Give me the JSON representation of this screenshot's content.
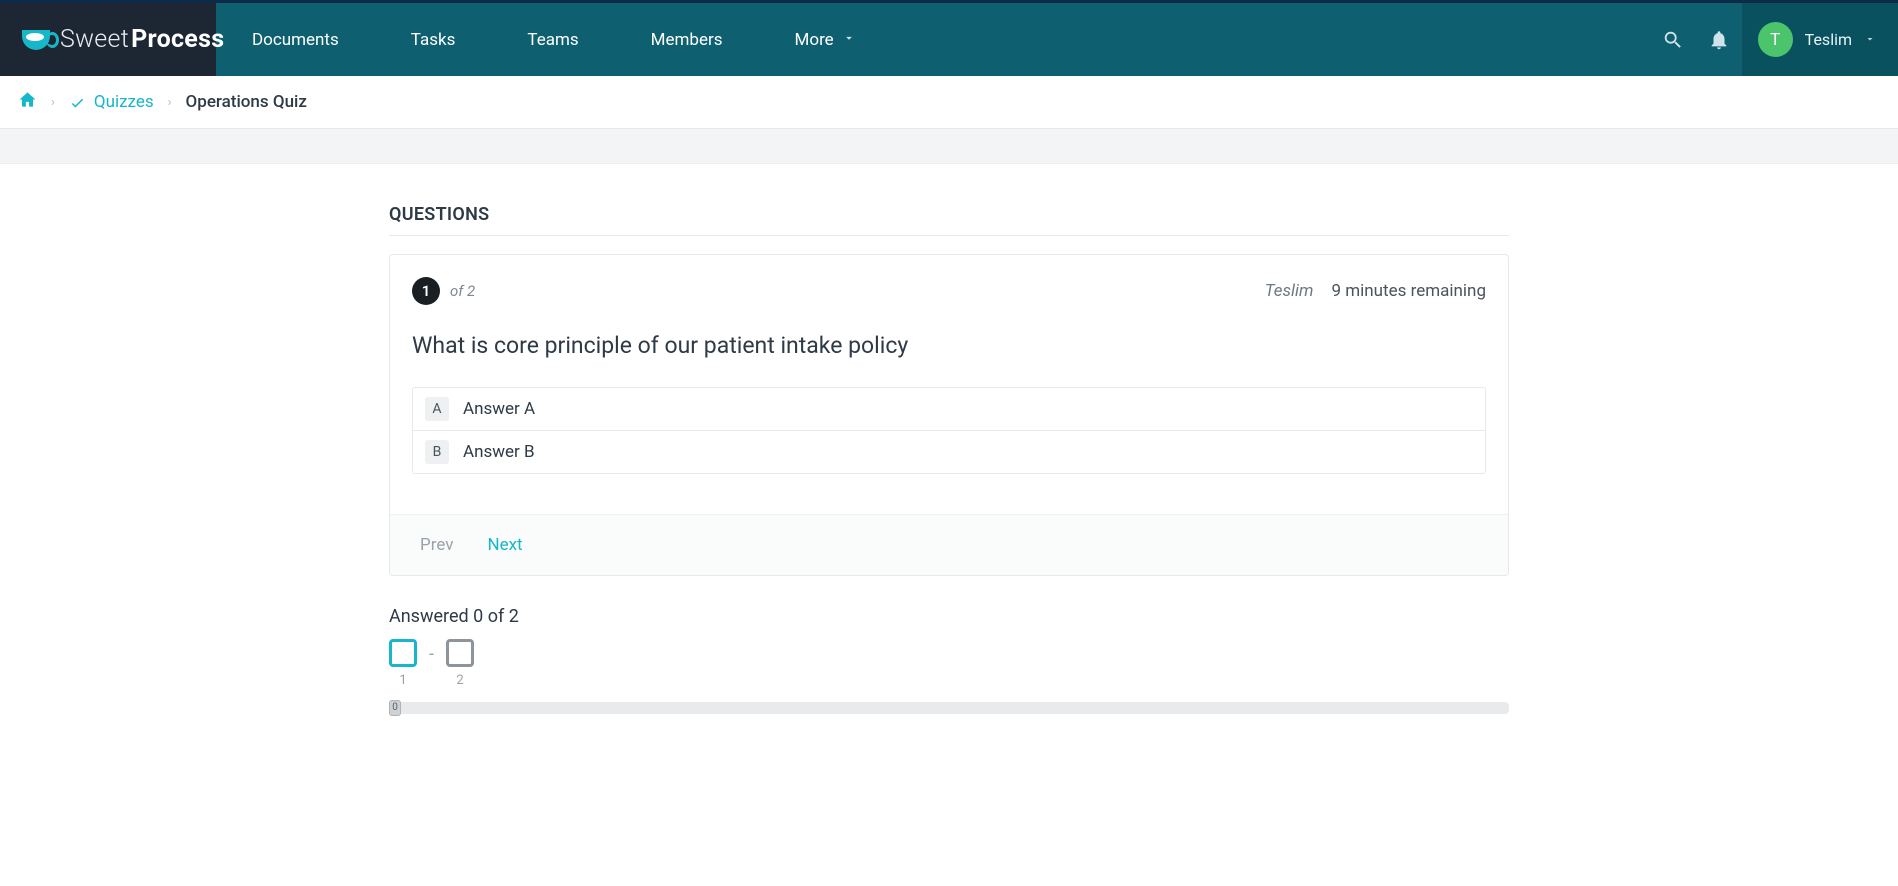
{
  "brand": {
    "sweet": "Sweet",
    "process": "Process"
  },
  "nav": {
    "items": [
      {
        "label": "Documents"
      },
      {
        "label": "Tasks"
      },
      {
        "label": "Teams"
      },
      {
        "label": "Members"
      },
      {
        "label": "More"
      }
    ]
  },
  "user": {
    "name": "Teslim",
    "initial": "T"
  },
  "breadcrumb": {
    "quizzes": "Quizzes",
    "current": "Operations Quiz"
  },
  "section_title": "QUESTIONS",
  "question": {
    "number": "1",
    "of_text": "of 2",
    "user": "Teslim",
    "time_remaining": "9 minutes remaining",
    "text": "What is core principle of our patient intake policy",
    "choices": [
      {
        "key": "A",
        "label": "Answer A"
      },
      {
        "key": "B",
        "label": "Answer B"
      }
    ],
    "prev": "Prev",
    "next": "Next"
  },
  "progress": {
    "text": "Answered 0 of 2",
    "boxes": [
      {
        "label": "1",
        "active": true
      },
      {
        "label": "2",
        "active": false
      }
    ],
    "slider_value": "0"
  }
}
